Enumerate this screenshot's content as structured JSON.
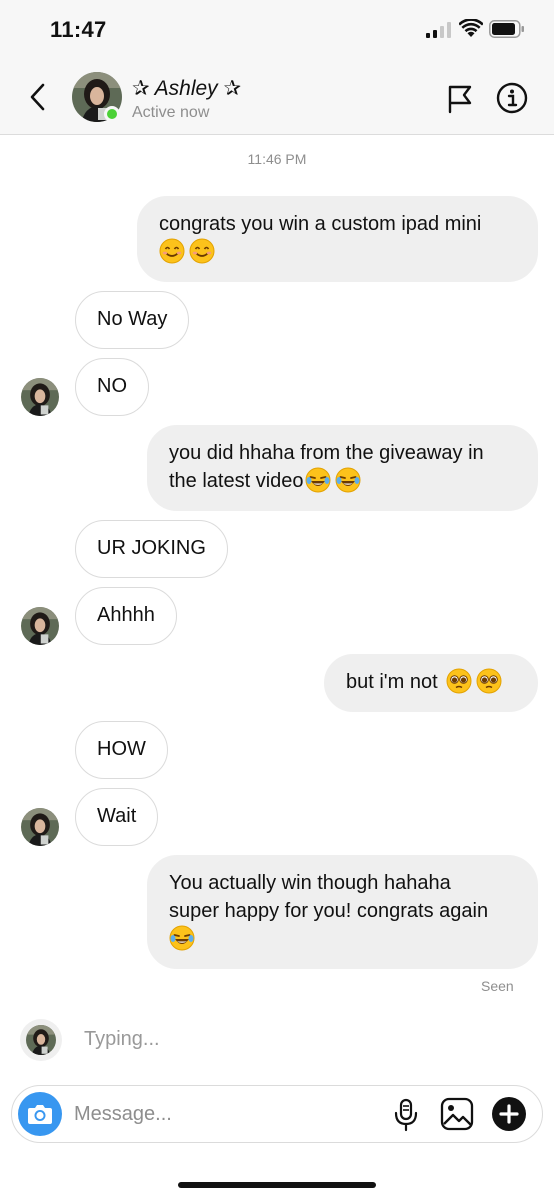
{
  "status_bar": {
    "time": "11:47"
  },
  "header": {
    "contact_name": "✰ Ashley ✰",
    "status": "Active now",
    "back_icon": "chevron-left-icon",
    "flag_icon": "flag-icon",
    "info_icon": "info-icon"
  },
  "chat": {
    "timestamp": "11:46 PM",
    "messages": [
      {
        "direction": "out",
        "lines": [
          "congrats you win a custom ipad mini",
          ""
        ],
        "emoji": [
          "smile",
          "smile"
        ]
      },
      {
        "direction": "in",
        "text": "No Way"
      },
      {
        "direction": "in",
        "text": "NO"
      },
      {
        "direction": "out",
        "lines": [
          "you did hhaha from the giveaway in",
          "the latest video"
        ],
        "emoji": [
          "laugh-tears",
          "laugh-tears"
        ]
      },
      {
        "direction": "in",
        "text": "UR JOKING"
      },
      {
        "direction": "in",
        "text": "Ahhhh"
      },
      {
        "direction": "out",
        "text": "but i'm not",
        "emoji": [
          "pleading",
          "pleading"
        ]
      },
      {
        "direction": "in",
        "text": "HOW"
      },
      {
        "direction": "in",
        "text": "Wait"
      },
      {
        "direction": "out",
        "lines": [
          "You actually win though hahaha",
          "super happy for you! congrats again"
        ],
        "emoji": [
          "laugh-tears"
        ]
      }
    ],
    "seen_label": "Seen",
    "typing_label": "Typing..."
  },
  "composer": {
    "placeholder": "Message...",
    "icons": [
      "camera-icon",
      "microphone-icon",
      "gallery-icon",
      "plus-icon"
    ]
  },
  "colors": {
    "accent": "#3897f0",
    "online": "#4cd137",
    "outgoing_bubble": "#efefef",
    "incoming_border": "#dbdbdb"
  }
}
